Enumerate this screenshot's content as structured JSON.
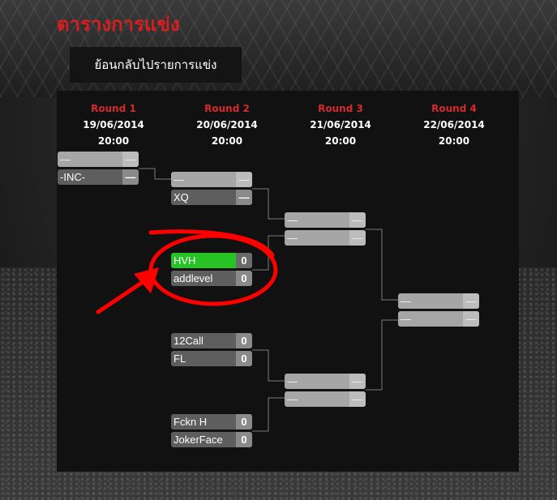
{
  "header": {
    "title": "ตารางการแข่ง",
    "back_label": "ย้อนกลับไปรายการแข่ง"
  },
  "rounds": [
    {
      "name": "Round 1",
      "date": "19/06/2014",
      "time": "20:00"
    },
    {
      "name": "Round 2",
      "date": "20/06/2014",
      "time": "20:00"
    },
    {
      "name": "Round 3",
      "date": "21/06/2014",
      "time": "20:00"
    },
    {
      "name": "Round 4",
      "date": "22/06/2014",
      "time": "20:00"
    }
  ],
  "matches": {
    "r1m1": {
      "a": {
        "name": "—",
        "score": "—"
      },
      "b": {
        "name": "-INC-",
        "score": "—"
      }
    },
    "r2m1": {
      "a": {
        "name": "—",
        "score": "—"
      },
      "b": {
        "name": "XQ",
        "score": "—"
      }
    },
    "r2m2": {
      "a": {
        "name": "HVH",
        "score": "0"
      },
      "b": {
        "name": "addlevel",
        "score": "0"
      }
    },
    "r2m3": {
      "a": {
        "name": "12Call",
        "score": "0"
      },
      "b": {
        "name": "FL",
        "score": "0"
      }
    },
    "r2m4": {
      "a": {
        "name": "Fckn H",
        "score": "0"
      },
      "b": {
        "name": "JokerFace",
        "score": "0"
      }
    },
    "r3m1": {
      "a": {
        "name": "—",
        "score": "—"
      },
      "b": {
        "name": "—",
        "score": "—"
      }
    },
    "r3m2": {
      "a": {
        "name": "—",
        "score": "—"
      },
      "b": {
        "name": "—",
        "score": "—"
      }
    },
    "r4m1": {
      "a": {
        "name": "—",
        "score": "—"
      },
      "b": {
        "name": "—",
        "score": "—"
      }
    }
  },
  "colors": {
    "accent_red": "#d81e1e",
    "win_green": "#27c224",
    "annotation": "#ff0000"
  },
  "annotation": {
    "icon": "red-ellipse-and-arrow-highlight"
  }
}
